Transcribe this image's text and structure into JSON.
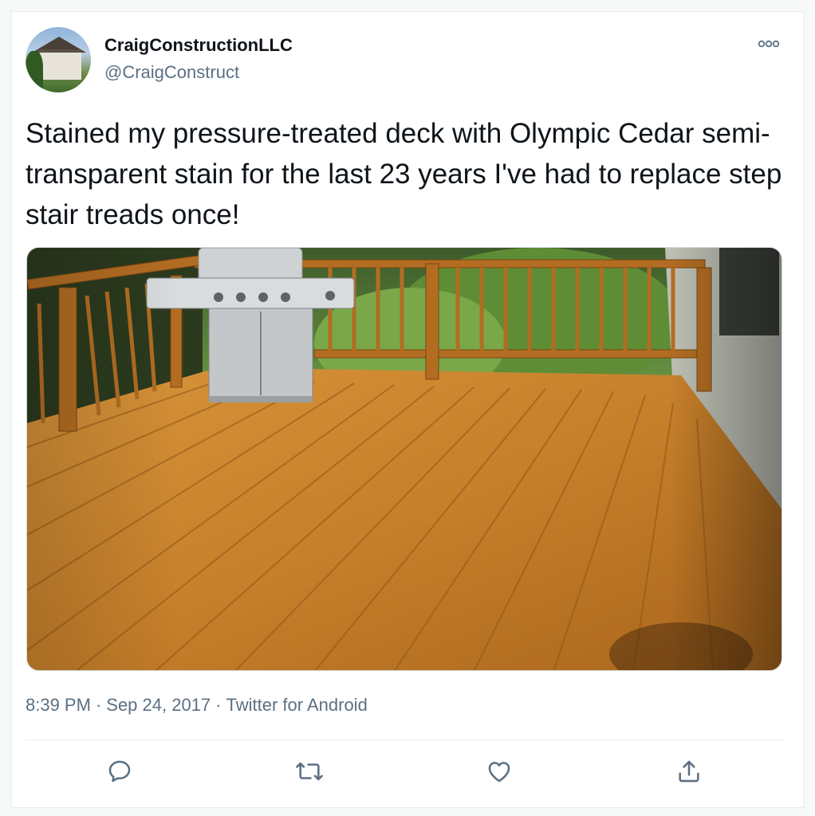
{
  "author": {
    "display_name": "CraigConstructionLLC",
    "handle": "@CraigConstruct"
  },
  "tweet": {
    "text": "Stained my pressure-treated deck with Olympic Cedar semi-transparent stain for the last 23 years I've had to replace step stair treads once!",
    "time": "8:39 PM",
    "date": "Sep 24, 2017",
    "source": "Twitter for Android",
    "separator": "·"
  },
  "icons": {
    "more": "more-horizontal-icon",
    "reply": "reply-icon",
    "retweet": "retweet-icon",
    "like": "like-icon",
    "share": "share-icon"
  },
  "colors": {
    "text": "#0f1419",
    "secondary": "#5b7083",
    "border": "#e6ecf0",
    "deck": "#c9822e"
  }
}
